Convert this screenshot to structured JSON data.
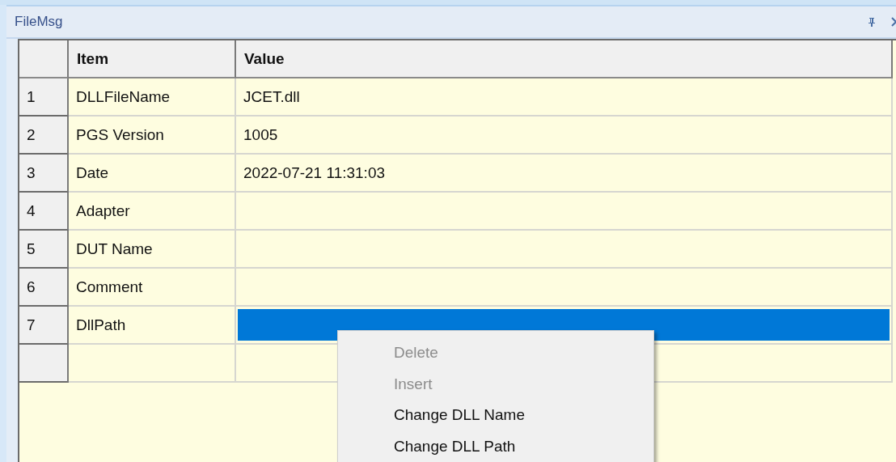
{
  "panel": {
    "title": "FileMsg"
  },
  "table": {
    "columns": [
      "Item",
      "Value"
    ],
    "rows": [
      {
        "number": "1",
        "item": "DLLFileName",
        "value": "JCET.dll",
        "selected": false
      },
      {
        "number": "2",
        "item": "PGS Version",
        "value": "1005",
        "selected": false
      },
      {
        "number": "3",
        "item": "Date",
        "value": "2022-07-21 11:31:03",
        "selected": false
      },
      {
        "number": "4",
        "item": "Adapter",
        "selected": false
      },
      {
        "number": "5",
        "item": "DUT Name",
        "selected": false
      },
      {
        "number": "6",
        "item": "Comment",
        "selected": false
      },
      {
        "number": "7",
        "item": "DllPath",
        "selected": true
      },
      {
        "selected": false
      }
    ]
  },
  "context_menu": {
    "items": [
      {
        "label": "Delete",
        "disabled": true
      },
      {
        "label": "Insert",
        "disabled": true
      },
      {
        "label": "Change DLL Name",
        "disabled": false
      },
      {
        "label": "Change DLL Path",
        "disabled": false
      }
    ]
  }
}
